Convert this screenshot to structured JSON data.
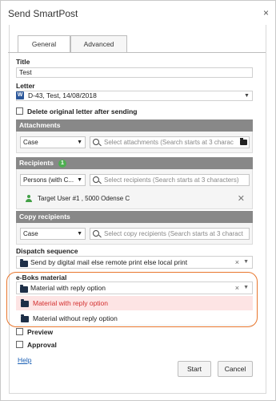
{
  "dialog": {
    "title": "Send SmartPost",
    "close_glyph": "×"
  },
  "tabs": [
    {
      "label": "General",
      "active": true
    },
    {
      "label": "Advanced",
      "active": false
    }
  ],
  "title_field": {
    "label": "Title",
    "value": "Test"
  },
  "letter_field": {
    "label": "Letter",
    "icon": "word-doc-icon",
    "icon_glyph": "W",
    "value": "D-43, Test, 14/08/2018",
    "caret": "▼"
  },
  "delete_original": {
    "label": "Delete original letter after sending",
    "checked": false
  },
  "attachments": {
    "heading": "Attachments",
    "type_value": "Case",
    "search_placeholder": "Select attachments (Search starts at 3 charac"
  },
  "recipients": {
    "heading": "Recipients",
    "count": "1",
    "type_value": "Persons (with C...",
    "search_placeholder": "Select recipients (Search starts at 3 characters)",
    "items": [
      {
        "label": "Target User #1 , 5000 Odense C",
        "remove_glyph": "✕"
      }
    ]
  },
  "copy_recipients": {
    "heading": "Copy recipients",
    "type_value": "Case",
    "search_placeholder": "Select copy recipients (Search starts at 3 charact"
  },
  "dispatch_sequence": {
    "label": "Dispatch sequence",
    "value": "Send by digital mail else remote print else local print",
    "clear_glyph": "×",
    "caret": "▼"
  },
  "eboks_material": {
    "label": "e-Boks material",
    "value": "Material with reply option",
    "clear_glyph": "×",
    "caret": "▼",
    "options": [
      {
        "label": "Material with reply option",
        "highlighted": true
      },
      {
        "label": "Material without reply option",
        "highlighted": false
      }
    ],
    "highlight_color": "#e8762d"
  },
  "preview": {
    "label": "Preview",
    "checked": false
  },
  "approval": {
    "label": "Approval",
    "checked": false
  },
  "footer": {
    "help_label": "Help",
    "start_label": "Start",
    "cancel_label": "Cancel"
  },
  "colors": {
    "section_header_bg": "#888888",
    "badge_green": "#4caf50",
    "highlight_row_bg": "#fde4e4",
    "highlight_row_text": "#d32f2f",
    "link": "#1a5fb4"
  }
}
